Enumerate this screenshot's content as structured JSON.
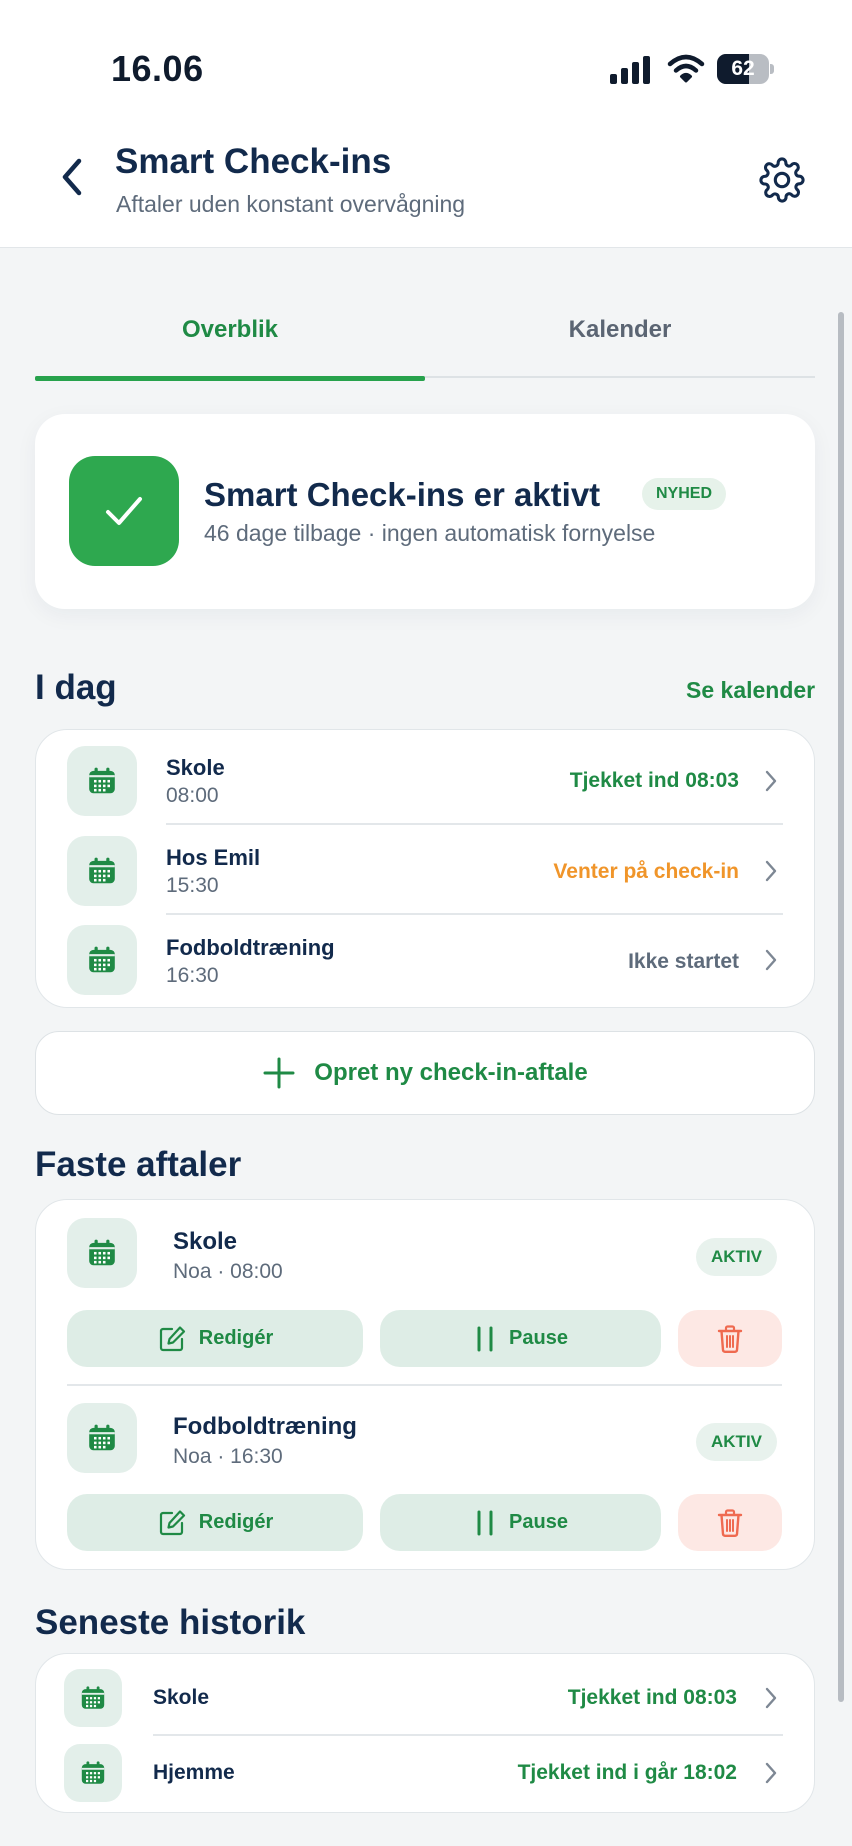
{
  "status_bar": {
    "time": "16.06",
    "battery": "62",
    "battery_level": 0.62
  },
  "header": {
    "title": "Smart Check-ins",
    "subtitle": "Aftaler uden konstant overvågning"
  },
  "tabs": [
    {
      "label": "Overblik",
      "active": true
    },
    {
      "label": "Kalender",
      "active": false
    }
  ],
  "hero": {
    "title": "Smart Check-ins er aktivt",
    "badge": "NYHED",
    "subtitle": "46 dage tilbage · ingen automatisk fornyelse"
  },
  "today": {
    "title": "I dag",
    "link": "Se kalender",
    "items": [
      {
        "name": "Skole",
        "time": "08:00",
        "status": "Tjekket ind 08:03",
        "status_color": "#1f8a45"
      },
      {
        "name": "Hos Emil",
        "time": "15:30",
        "status": "Venter på check-in",
        "status_color": "#f0952a"
      },
      {
        "name": "Fodboldtræning",
        "time": "16:30",
        "status": "Ikke startet",
        "status_color": "#5e6b7b"
      }
    ]
  },
  "create_button": {
    "label": "Opret ny check-in-aftale"
  },
  "fixed": {
    "title": "Faste aftaler",
    "items": [
      {
        "name": "Skole",
        "detail": "Noa · 08:00",
        "badge": "AKTIV",
        "edit_label": "Redigér",
        "pause_label": "Pause"
      },
      {
        "name": "Fodboldtræning",
        "detail": "Noa · 16:30",
        "badge": "AKTIV",
        "edit_label": "Redigér",
        "pause_label": "Pause"
      }
    ]
  },
  "history": {
    "title": "Seneste historik",
    "items": [
      {
        "name": "Skole",
        "status": "Tjekket ind 08:03"
      },
      {
        "name": "Hjemme",
        "status": "Tjekket ind i går 18:02"
      }
    ]
  },
  "colors": {
    "accent": "#1f8a45",
    "accent_bright": "#2ea84f",
    "pending": "#f0952a",
    "neutral": "#5e6b7b",
    "text": "#122a4c",
    "danger": "#ef6a50"
  },
  "icons": {
    "back": "chevron-left-icon",
    "settings": "gear-icon",
    "check": "check-icon",
    "calendar": "calendar-icon",
    "chevron": "chevron-right-icon",
    "plus": "plus-icon",
    "edit": "edit-icon",
    "pause": "pause-icon",
    "delete": "trash-icon"
  }
}
